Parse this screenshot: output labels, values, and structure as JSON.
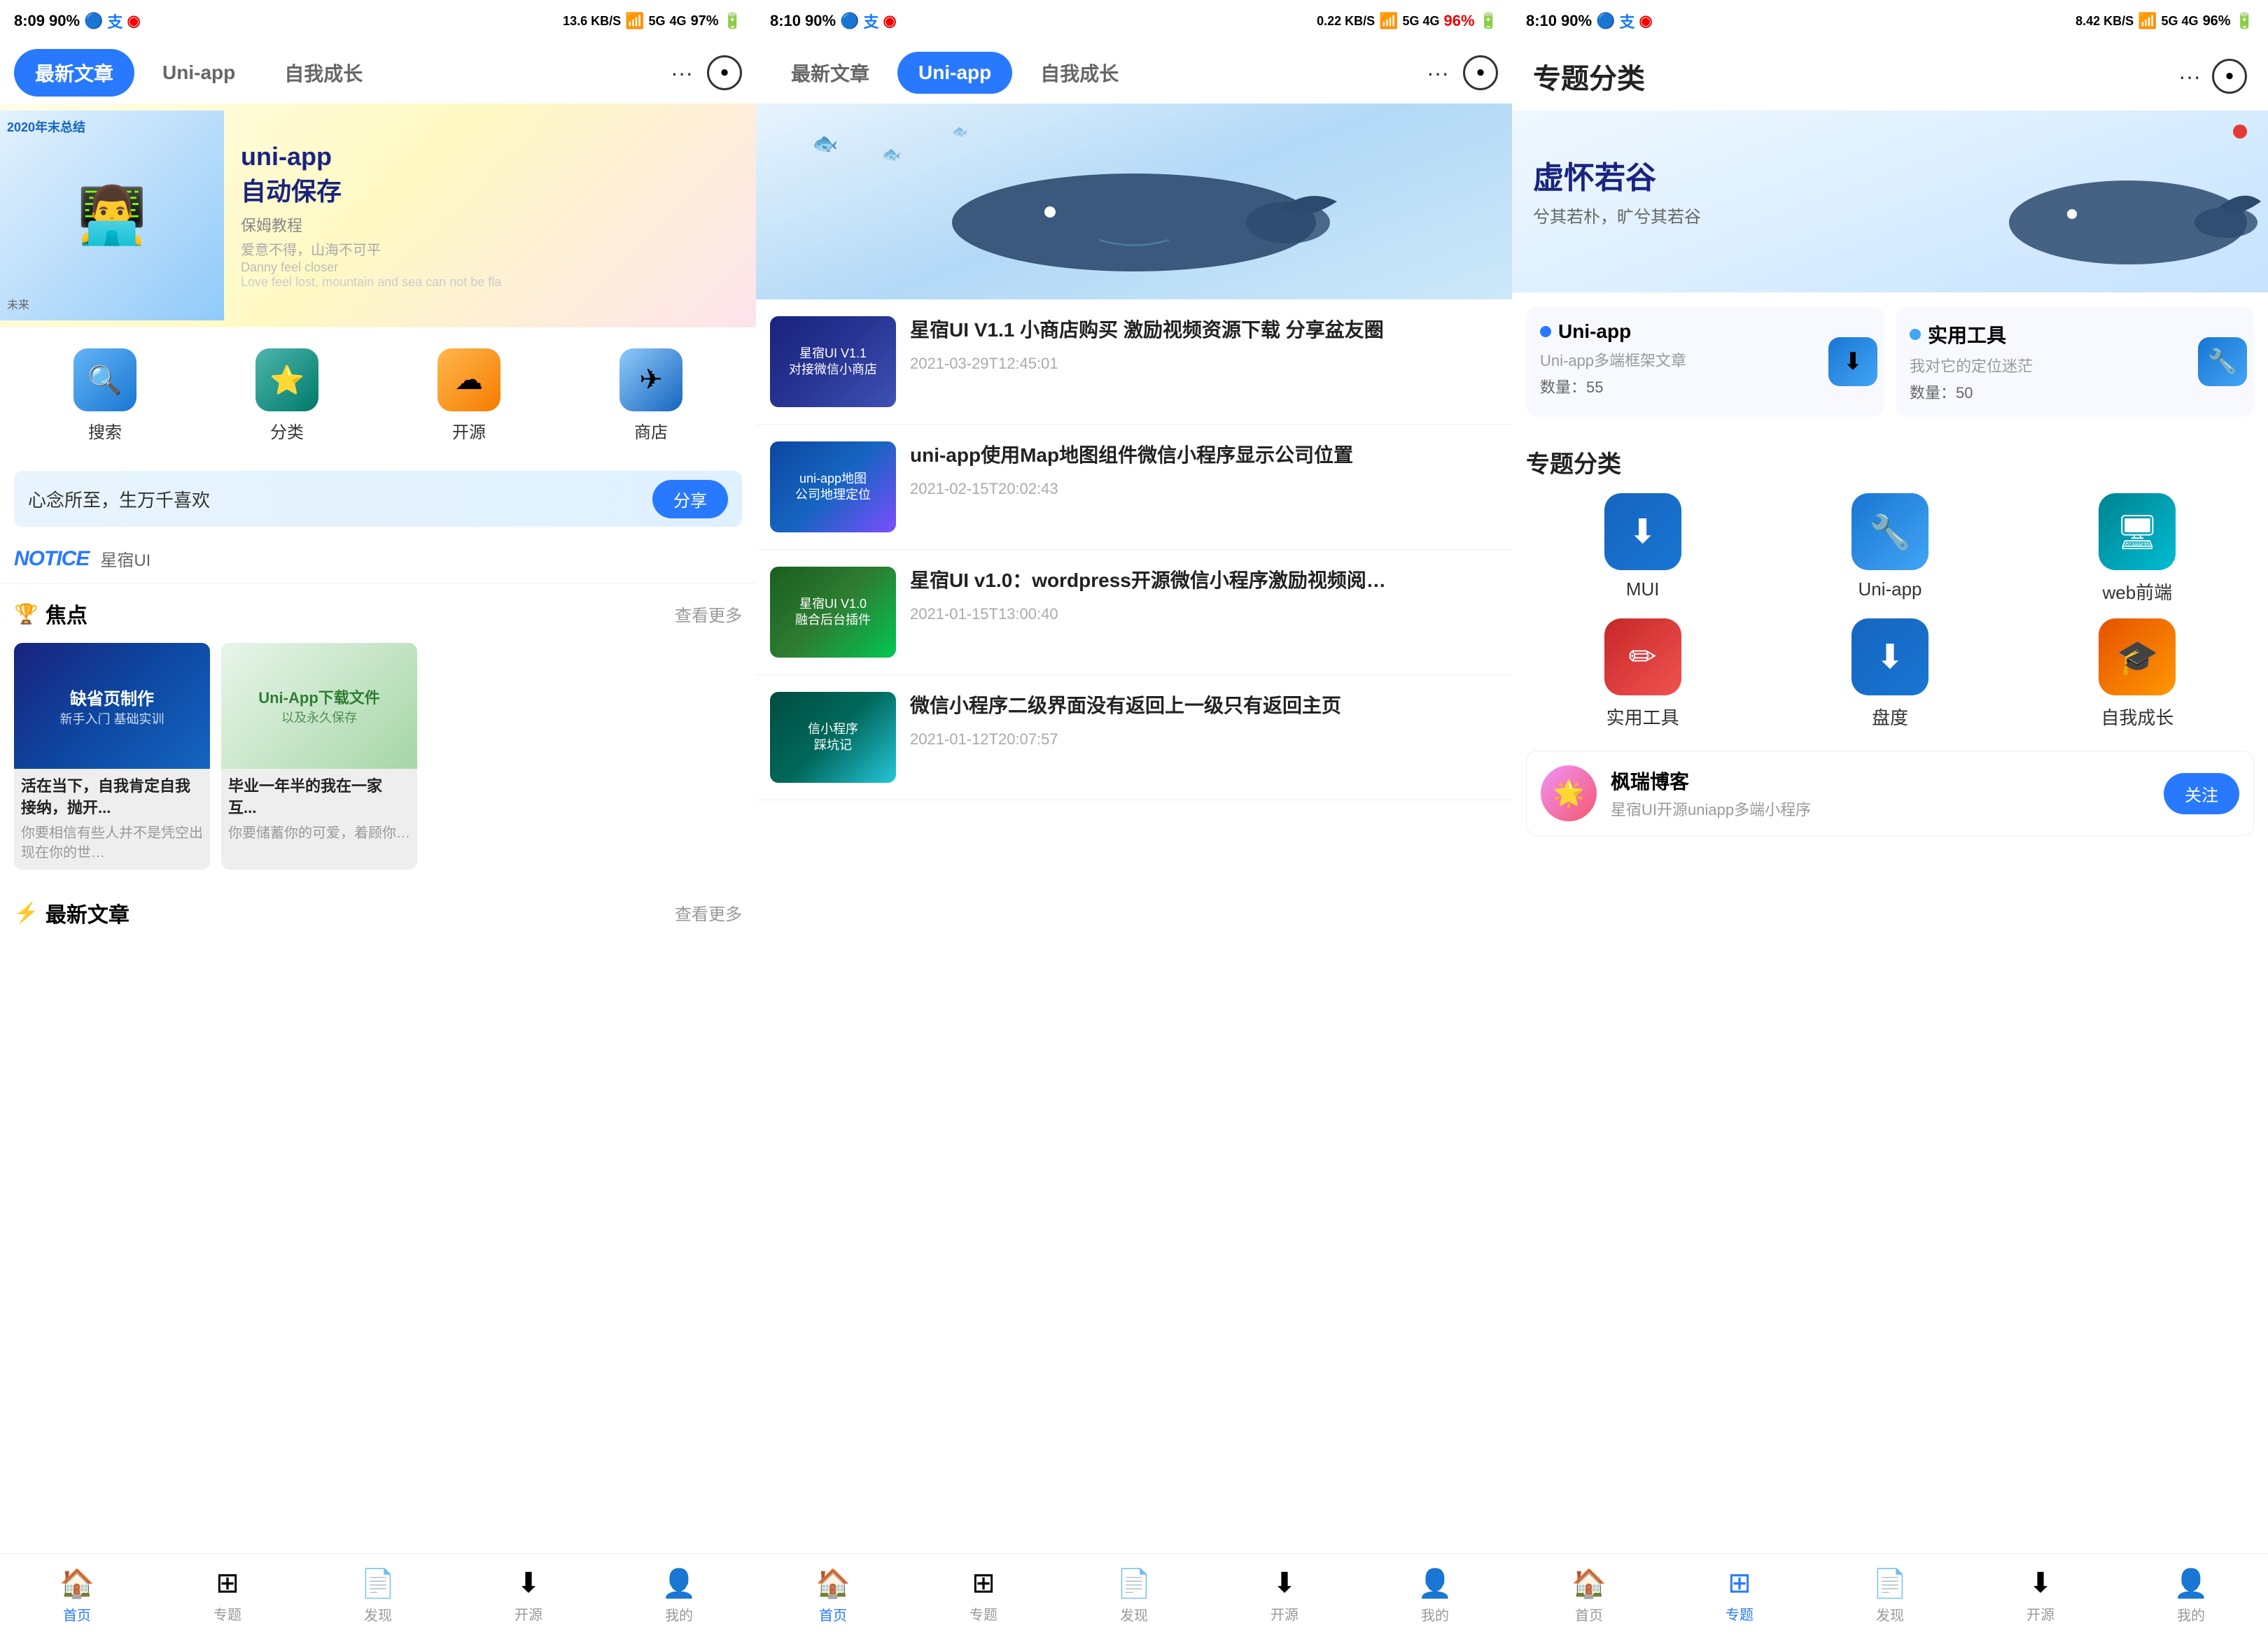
{
  "screens": [
    {
      "id": "screen1",
      "status": {
        "time": "8:09",
        "signal": "90%",
        "network": "13.6 KB/S",
        "wifi": "HD!",
        "g5": "5G",
        "g4": "4G",
        "battery": "97%"
      },
      "tabs": [
        "最新文章",
        "Uni-app",
        "自我成长"
      ],
      "active_tab": 0,
      "hero": {
        "title1": "uni-app",
        "title2": "自动保存",
        "subtitle": "保姆教程",
        "desc1": "爱意不得，山海不可平",
        "desc2": "Danny feel closer",
        "desc3": "Love feel lost, mountain and sea can not be fla"
      },
      "icons": [
        {
          "label": "搜索",
          "icon": "🔍",
          "color": "icon-search"
        },
        {
          "label": "分类",
          "icon": "⭐",
          "color": "icon-category"
        },
        {
          "label": "开源",
          "icon": "☁",
          "color": "icon-open"
        },
        {
          "label": "商店",
          "icon": "✈",
          "color": "icon-shop"
        }
      ],
      "banner": {
        "text": "心念所至，生万千喜欢",
        "btn": "分享"
      },
      "notice": {
        "label": "NOTICE",
        "text": "星宿UI"
      },
      "focus": {
        "title": "焦点",
        "more": "查看更多",
        "cards": [
          {
            "bg": "focus-img-1",
            "text1": "缺省页制作",
            "text2": "新手入门 基础实训",
            "desc": "活在当下，自我肯定自我接纳，抛开..."
          },
          {
            "bg": "focus-img-2",
            "text1": "Uni-App下载文件",
            "text2": "以及永久保存",
            "desc": "毕业一年半的我在一家互..."
          }
        ]
      },
      "latest": {
        "title": "最新文章",
        "more": "查看更多"
      },
      "nav": [
        {
          "label": "首页",
          "icon": "🏠",
          "active": true
        },
        {
          "label": "专题",
          "icon": "⊞"
        },
        {
          "label": "发现",
          "icon": "📄"
        },
        {
          "label": "开源",
          "icon": "⬇"
        },
        {
          "label": "我的",
          "icon": "👤"
        }
      ]
    },
    {
      "id": "screen2",
      "status": {
        "time": "8:10",
        "network": "0.22 KB/S",
        "battery": "96%"
      },
      "tabs": [
        "最新文章",
        "Uni-app",
        "自我成长"
      ],
      "active_tab": 1,
      "articles": [
        {
          "title": "星宿UI V1.1 小商店购买 激励视频资源下载 分享盆友圈",
          "time": "2021-03-29T12:45:01",
          "thumb_class": "thumb-1",
          "thumb_text": "星宿UI V1.1\n对接微信小商店"
        },
        {
          "title": "uni-app使用Map地图组件微信小程序显示公司位置",
          "time": "2021-02-15T20:02:43",
          "thumb_class": "thumb-2",
          "thumb_text": "uni-app地图\n公司地理定位"
        },
        {
          "title": "星宿UI v1.0：wordpress开源微信小程序激励视频阅…",
          "time": "2021-01-15T13:00:40",
          "thumb_class": "thumb-3",
          "thumb_text": "星宿UI V1.0\n融合后台插件"
        },
        {
          "title": "微信小程序二级界面没有返回上一级只有返回主页",
          "time": "2021-01-12T20:07:57",
          "thumb_class": "thumb-4",
          "thumb_text": "信小程序 踩坑记"
        }
      ],
      "nav": [
        {
          "label": "首页",
          "icon": "🏠",
          "active": true
        },
        {
          "label": "专题",
          "icon": "⊞"
        },
        {
          "label": "发现",
          "icon": "📄"
        },
        {
          "label": "开源",
          "icon": "⬇"
        },
        {
          "label": "我的",
          "icon": "👤"
        }
      ]
    },
    {
      "id": "screen3",
      "status": {
        "time": "8:10",
        "network": "",
        "battery": "96%"
      },
      "header": {
        "title": "专题分类"
      },
      "hero": {
        "title": "虚怀若谷",
        "subtitle": "兮其若朴，旷兮其若谷"
      },
      "featured": [
        {
          "dot_color": "dot-blue",
          "name": "Uni-app",
          "desc": "Uni-app多端框架文章",
          "count": "数量：55",
          "icon": "⬇",
          "icon_bg": "bg-blue"
        },
        {
          "dot_color": "dot-blue2",
          "name": "实用工具",
          "desc": "我对它的定位迷茫",
          "count": "数量：50",
          "icon": "🔧",
          "icon_bg": "bg-blue"
        }
      ],
      "topic_section": {
        "title": "专题分类",
        "items": [
          {
            "label": "MUI",
            "icon": "⬇",
            "bg": "#1976d2"
          },
          {
            "label": "Uni-app",
            "icon": "🔧",
            "bg": "#2979ff"
          },
          {
            "label": "web前端",
            "icon": "🖥",
            "bg": "#00bcd4"
          },
          {
            "label": "实用工具",
            "icon": "✏",
            "bg": "#e53935"
          },
          {
            "label": "盘度",
            "icon": "⬇",
            "bg": "#1976d2"
          },
          {
            "label": "自我成长",
            "icon": "🎓",
            "bg": "#ff9800"
          }
        ]
      },
      "author": {
        "name": "枫瑞博客",
        "desc": "星宿UI开源uniapp多端小程序",
        "follow_label": "关注"
      },
      "nav": [
        {
          "label": "首页",
          "icon": "🏠"
        },
        {
          "label": "专题",
          "icon": "⊞",
          "active": true
        },
        {
          "label": "发现",
          "icon": "📄"
        },
        {
          "label": "开源",
          "icon": "⬇"
        },
        {
          "label": "我的",
          "icon": "👤"
        }
      ]
    }
  ]
}
